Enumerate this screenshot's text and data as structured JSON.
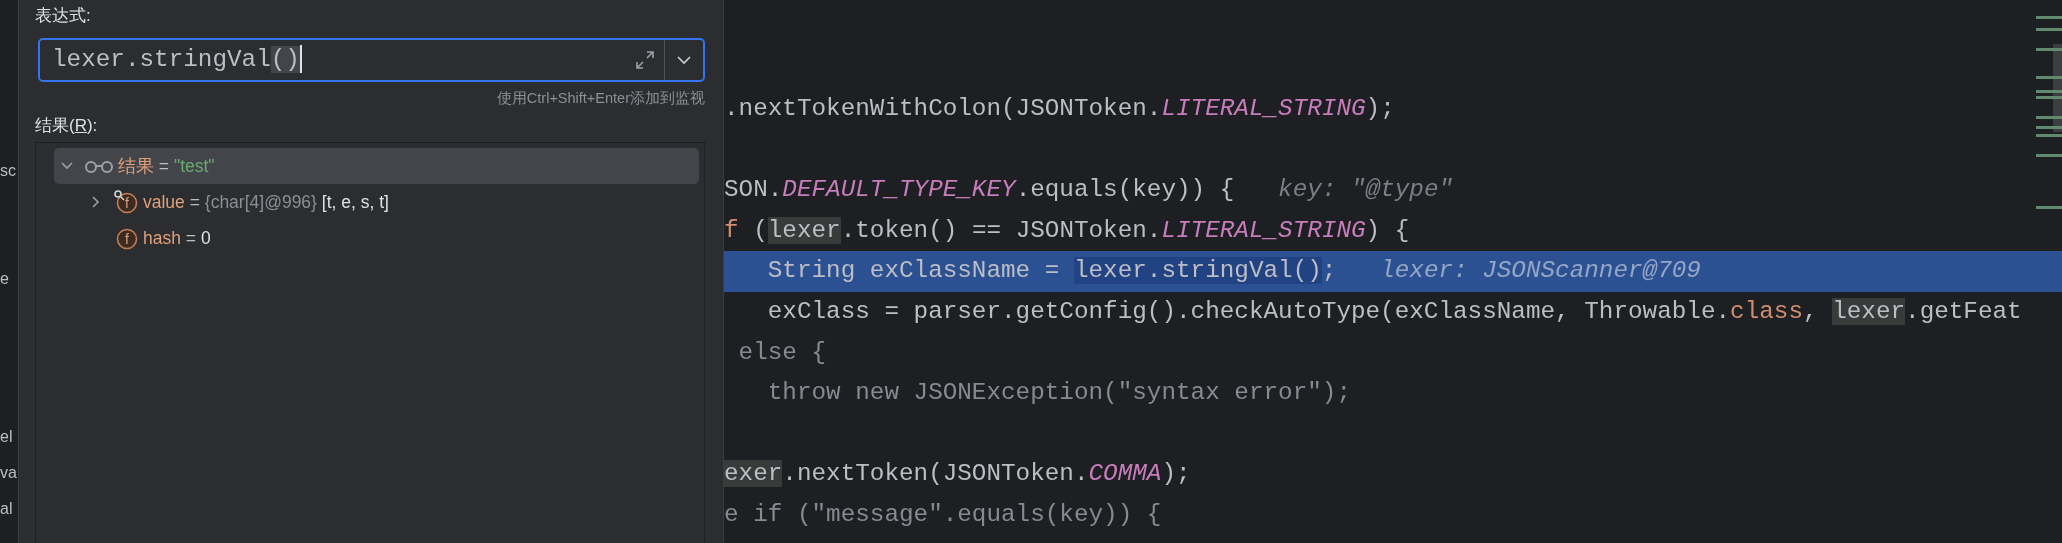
{
  "side_fragments": [
    "sc",
    "e",
    "el",
    "va",
    "al"
  ],
  "evaluate": {
    "expression_label": "表达式:",
    "expression": {
      "value": "lexer.stringVal()",
      "brace_highlight": true,
      "caret": true
    },
    "hint": "使用Ctrl+Shift+Enter添加到监视",
    "result_label": {
      "before": "结果(",
      "mnemonic": "R",
      "after": "):"
    },
    "tree": [
      {
        "kind": "watch",
        "name": "结果",
        "separator": "=",
        "value": {
          "text": "\"test\"",
          "kind": "string"
        },
        "selected": true,
        "expanded": true,
        "children": [
          {
            "kind": "field",
            "letter": "f",
            "badge": true,
            "name": "value",
            "separator": "=",
            "type": "{char[4]@996}",
            "value": {
              "text": "[t, e, s, t]",
              "kind": "plain"
            },
            "selected": false,
            "expanded": false
          },
          {
            "kind": "field",
            "letter": "f",
            "badge": false,
            "name": "hash",
            "separator": "=",
            "value": {
              "text": "0",
              "kind": "plain"
            },
            "selected": false
          }
        ]
      }
    ]
  },
  "code_lines": [
    {
      "kind": "code",
      "current": false,
      "segments": [
        {
          "text": ".nextTokenWithColon(JSONToken.",
          "kind": "plain"
        },
        {
          "text": "LITERAL_STRING",
          "kind": "constant"
        },
        {
          "text": ");",
          "kind": "plain"
        }
      ]
    },
    {
      "kind": "blank"
    },
    {
      "kind": "code",
      "current": false,
      "segments": [
        {
          "text": "SON.",
          "kind": "plain"
        },
        {
          "text": "DEFAULT_TYPE_KEY",
          "kind": "constant"
        },
        {
          "text": ".equals(key)) {",
          "kind": "plain"
        }
      ],
      "hint": "key: \"@type\""
    },
    {
      "kind": "code",
      "current": false,
      "segments": [
        {
          "text": "f",
          "kind": "keyword"
        },
        {
          "text": " (",
          "kind": "plain"
        },
        {
          "text": "lexer",
          "kind": "usage"
        },
        {
          "text": ".token() == JSONToken.",
          "kind": "plain"
        },
        {
          "text": "LITERAL_STRING",
          "kind": "constant"
        },
        {
          "text": ") {",
          "kind": "plain"
        }
      ]
    },
    {
      "kind": "code",
      "current": true,
      "segments": [
        {
          "text": "   String exClassName = ",
          "kind": "plain"
        },
        {
          "text": "lexer.stringVal()",
          "kind": "evaluated"
        },
        {
          "text": ";",
          "kind": "plain"
        }
      ],
      "hint": "lexer: JSONScanner@709"
    },
    {
      "kind": "code",
      "current": false,
      "segments": [
        {
          "text": "   exClass = parser.getConfig().checkAutoType(exClassName, Throwable.",
          "kind": "plain"
        },
        {
          "text": "class",
          "kind": "keyword"
        },
        {
          "text": ", ",
          "kind": "plain"
        },
        {
          "text": "lexer",
          "kind": "usage"
        },
        {
          "text": ".getFeat",
          "kind": "plain"
        }
      ]
    },
    {
      "kind": "code",
      "current": false,
      "segments": [
        {
          "text": " else {",
          "kind": "dim"
        }
      ]
    },
    {
      "kind": "code",
      "current": false,
      "segments": [
        {
          "text": "   throw new JSONException(\"syntax error\");",
          "kind": "dim"
        }
      ]
    },
    {
      "kind": "blank"
    },
    {
      "kind": "code",
      "current": false,
      "segments": [
        {
          "text": "exer",
          "kind": "usage"
        },
        {
          "text": ".nextToken(JSONToken.",
          "kind": "plain"
        },
        {
          "text": "COMMA",
          "kind": "constant"
        },
        {
          "text": ");",
          "kind": "plain"
        }
      ]
    },
    {
      "kind": "code",
      "current": false,
      "segments": [
        {
          "text": "e if (\"message\".equals(key)) {",
          "kind": "dim"
        }
      ]
    }
  ]
}
